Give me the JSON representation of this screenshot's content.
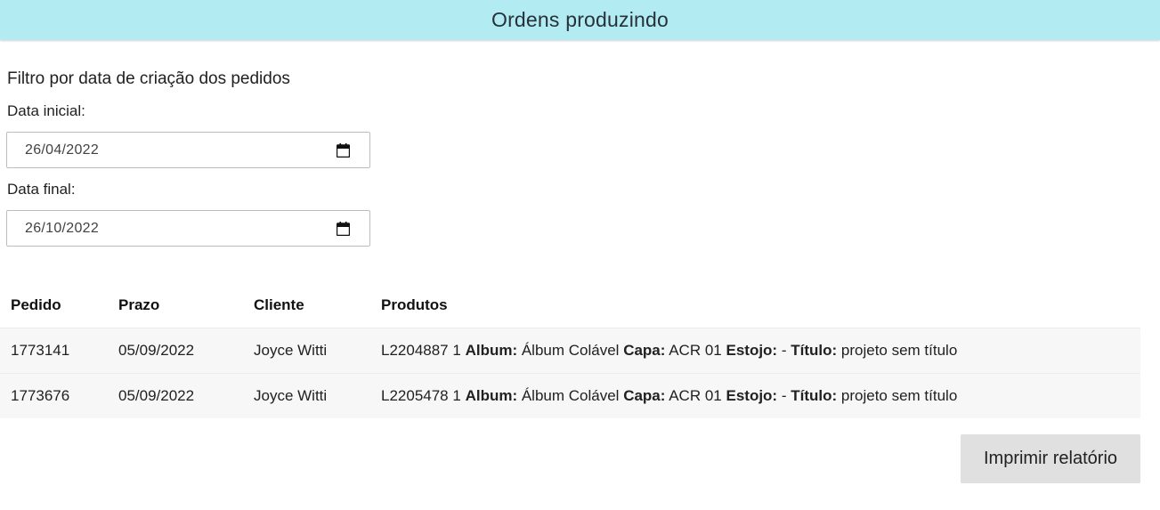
{
  "header": {
    "title": "Ordens produzindo",
    "background": "#b2ebf2"
  },
  "filter": {
    "title": "Filtro por data de criação dos pedidos",
    "start_label": "Data inicial:",
    "start_value": "26/04/2022",
    "end_label": "Data final:",
    "end_value": "26/10/2022",
    "calendar_icon": "calendar-icon"
  },
  "table": {
    "columns": [
      "Pedido",
      "Prazo",
      "Cliente",
      "Produtos"
    ],
    "rows": [
      {
        "pedido": "1773141",
        "prazo": "05/09/2022",
        "cliente": "Joyce Witti",
        "produtos": {
          "prefix": "L2204887 1",
          "album_label": "Album:",
          "album_value": "Álbum Colável",
          "capa_label": "Capa:",
          "capa_value": "ACR 01",
          "estojo_label": "Estojo:",
          "estojo_value": "-",
          "titulo_label": "Título:",
          "titulo_value": "projeto sem título"
        }
      },
      {
        "pedido": "1773676",
        "prazo": "05/09/2022",
        "cliente": "Joyce Witti",
        "produtos": {
          "prefix": "L2205478 1",
          "album_label": "Album:",
          "album_value": "Álbum Colável",
          "capa_label": "Capa:",
          "capa_value": "ACR 01",
          "estojo_label": "Estojo:",
          "estojo_value": "-",
          "titulo_label": "Título:",
          "titulo_value": "projeto sem título"
        }
      }
    ]
  },
  "actions": {
    "print_label": "Imprimir relatório"
  }
}
